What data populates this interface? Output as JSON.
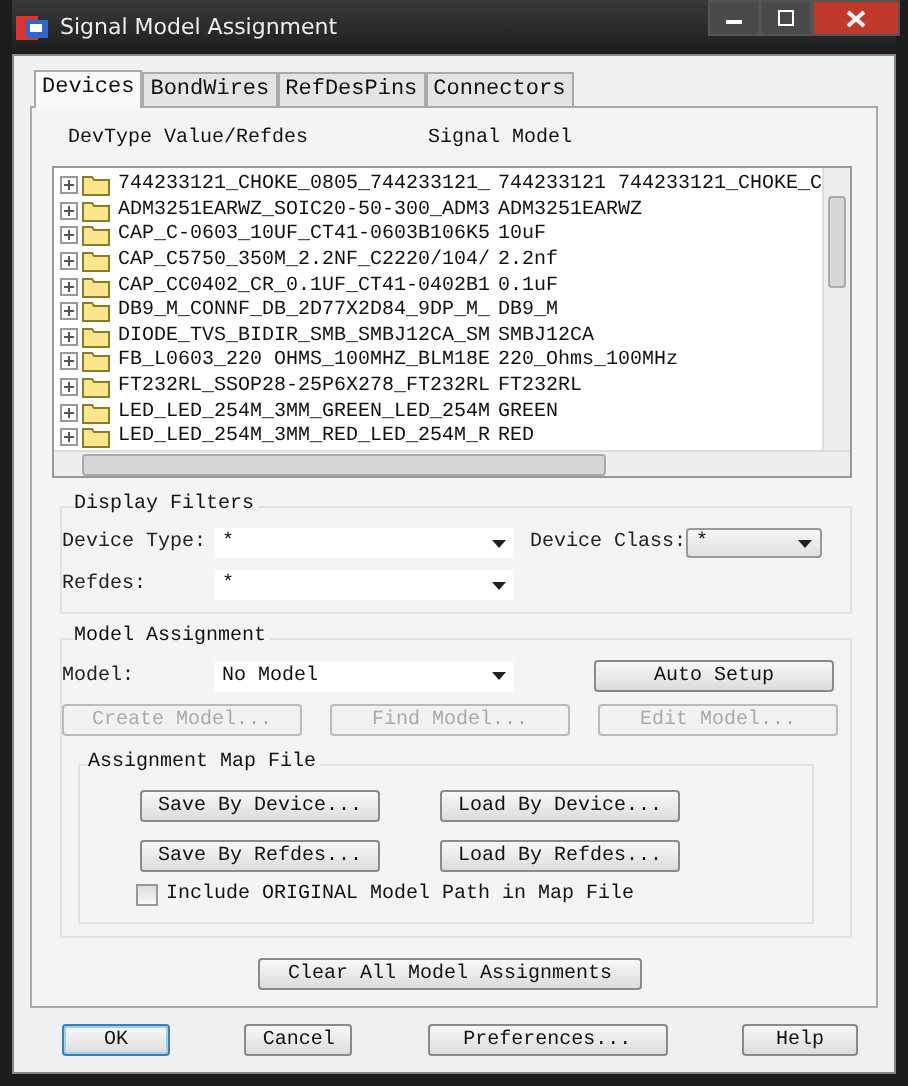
{
  "window": {
    "title": "Signal Model Assignment"
  },
  "tabs": [
    {
      "label": "Devices",
      "selected": true
    },
    {
      "label": "BondWires",
      "selected": false
    },
    {
      "label": "RefDesPins",
      "selected": false
    },
    {
      "label": "Connectors",
      "selected": false
    }
  ],
  "list": {
    "columns": [
      "DevType Value/Refdes",
      "Signal Model"
    ],
    "rows": [
      {
        "name": "744233121_CHOKE_0805_744233121_",
        "model": "744233121 744233121_CHOKE_C",
        "expanded": false
      },
      {
        "name": "ADM3251EARWZ_SOIC20-50-300_ADM3",
        "model": "ADM3251EARWZ",
        "expanded": false
      },
      {
        "name": "CAP_C-0603_10UF_CT41-0603B106K5",
        "model": "10uF",
        "expanded": false
      },
      {
        "name": "CAP_C5750_350M_2.2NF_C2220/104/",
        "model": "2.2nf",
        "expanded": false
      },
      {
        "name": "CAP_CC0402_CR_0.1UF_CT41-0402B1",
        "model": "0.1uF",
        "expanded": false
      },
      {
        "name": "DB9_M_CONNF_DB_2D77X2D84_9DP_M_",
        "model": "DB9_M",
        "expanded": false
      },
      {
        "name": "DIODE_TVS_BIDIR_SMB_SMBJ12CA_SM",
        "model": "SMBJ12CA",
        "expanded": false
      },
      {
        "name": "FB_L0603_220 OHMS_100MHZ_BLM18E",
        "model": "220_Ohms_100MHz",
        "expanded": false
      },
      {
        "name": "FT232RL_SSOP28-25P6X278_FT232RL",
        "model": "FT232RL",
        "expanded": false
      },
      {
        "name": "LED_LED_254M_3MM_GREEN_LED_254M",
        "model": "GREEN",
        "expanded": false
      },
      {
        "name": "LED_LED_254M_3MM_RED_LED_254M_R",
        "model": "RED",
        "expanded": false
      }
    ]
  },
  "display_filters": {
    "title": "Display Filters",
    "device_type": {
      "label": "Device Type:",
      "value": "*"
    },
    "device_class": {
      "label": "Device Class:",
      "value": "*"
    },
    "refdes": {
      "label": "Refdes:",
      "value": "*"
    }
  },
  "model_assignment": {
    "title": "Model Assignment",
    "model": {
      "label": "Model:",
      "value": "No Model"
    },
    "auto_setup": {
      "label": "Auto Setup",
      "disabled": false
    },
    "actions": [
      {
        "label": "Create Model...",
        "disabled": true
      },
      {
        "label": "Find Model...",
        "disabled": true
      },
      {
        "label": "Edit Model...",
        "disabled": true
      }
    ]
  },
  "map_file": {
    "title": "Assignment Map File",
    "buttons": [
      {
        "label": "Save By Device...",
        "disabled": false
      },
      {
        "label": "Load By Device...",
        "disabled": false
      },
      {
        "label": "Save By Refdes...",
        "disabled": false
      },
      {
        "label": "Load By Refdes...",
        "disabled": false
      }
    ],
    "include_path": {
      "label": "Include ORIGINAL Model Path in Map File",
      "checked": false
    }
  },
  "clear_all": {
    "label": "Clear All Model Assignments",
    "disabled": false
  },
  "footer": [
    {
      "label": "OK",
      "default": true
    },
    {
      "label": "Cancel",
      "default": false
    },
    {
      "label": "Preferences...",
      "default": false
    },
    {
      "label": "Help",
      "default": false
    }
  ]
}
